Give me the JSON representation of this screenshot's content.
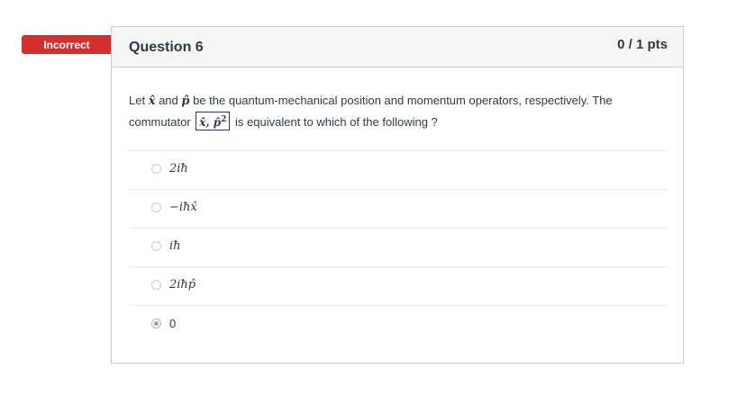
{
  "result_badge": "Incorrect",
  "question": {
    "title": "Question 6",
    "points": "0 / 1 pts",
    "text_part1": "Let ",
    "x_hat": "x̂",
    "text_part2": " and ",
    "p_hat": "p̂",
    "text_part3": " be the quantum-mechanical position and momentum operators, respectively. The commutator ",
    "commutator": "x̂, p̂",
    "commutator_power": "2",
    "text_part4": " is equivalent to which of the following ?"
  },
  "answers": [
    {
      "label": "2iħ",
      "selected": false
    },
    {
      "label": "−iħx̂",
      "selected": false
    },
    {
      "label": "iħ",
      "selected": false
    },
    {
      "label": "2iħp̂",
      "selected": false
    },
    {
      "label": "0",
      "selected": true
    }
  ],
  "colors": {
    "badge": "#d32f2f",
    "border": "#c7cdd1",
    "header_bg": "#f5f5f5"
  }
}
